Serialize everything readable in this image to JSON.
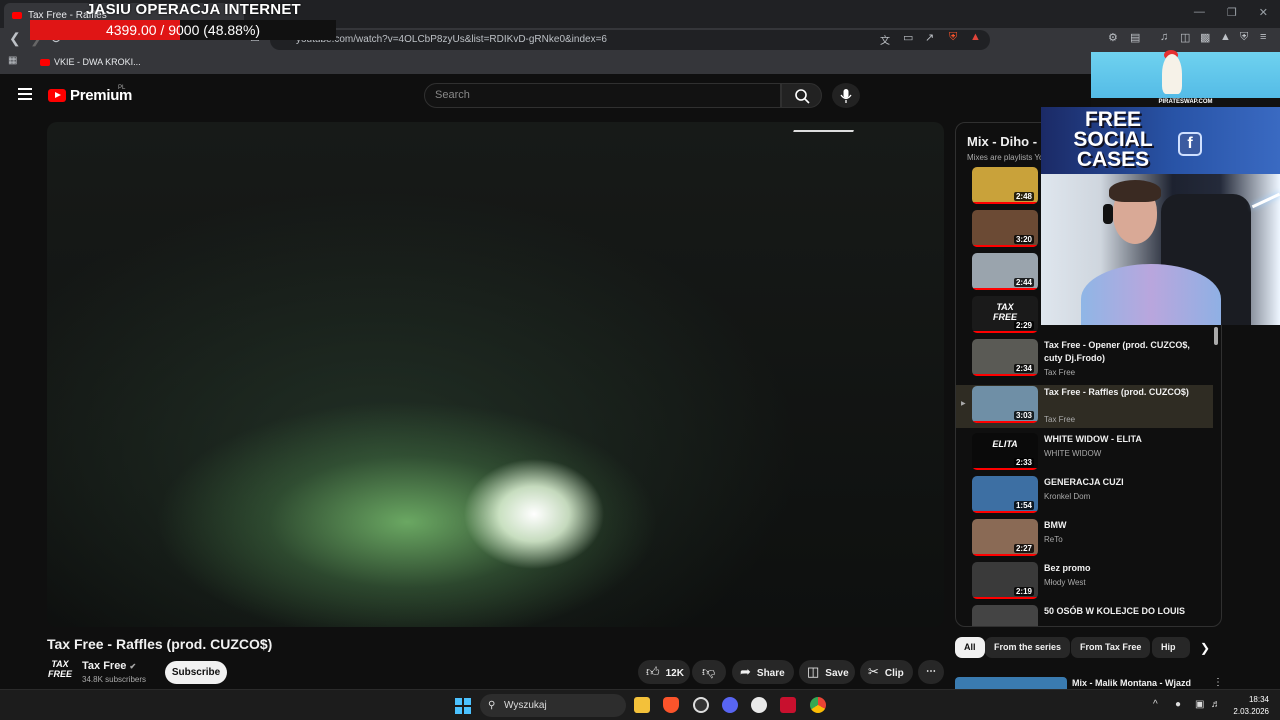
{
  "overlay": {
    "title": "JASIU OPERACJA INTERNET",
    "progress_text": "4399.00 / 9000 (48.88%)",
    "progress_fraction": 0.4888
  },
  "browser": {
    "tab_title": "Tax Free - Raffles",
    "url": "youtube.com/watch?v=4OLCbP8zyUs&list=RDIKvD-gRNke0&index=6",
    "bookmark_label": "VKIE - DWA KROKI..."
  },
  "youtube": {
    "logo_text": "Premium",
    "logo_region": "PL",
    "search_placeholder": "Search"
  },
  "video": {
    "title": "Tax Free - Raffles (prod. CUZCO$)",
    "channel_logo": "TAX FREE",
    "channel_name": "Tax Free",
    "subscribers": "34.8K subscribers",
    "subscribe_label": "Subscribe",
    "likes": "12K",
    "share_label": "Share",
    "save_label": "Save",
    "clip_label": "Clip"
  },
  "playlist": {
    "title": "Mix - Diho -",
    "subtitle": "Mixes are playlists Yo",
    "items": [
      {
        "title": "",
        "artist": "",
        "duration": "2:48",
        "color": "#c9a23a"
      },
      {
        "title": "",
        "artist": "",
        "duration": "3:20",
        "color": "#6b4a34"
      },
      {
        "title": "",
        "artist": "",
        "duration": "2:44",
        "color": "#9aa4ad"
      },
      {
        "title": "",
        "artist": "",
        "duration": "2:29",
        "color": "#1a1a1a",
        "thumb_text": "TAX FREE"
      },
      {
        "title": "Tax Free - Opener (prod. CUZCO$, cuty Dj.Frodo)",
        "artist": "Tax Free",
        "duration": "2:34",
        "color": "#5a5a55"
      },
      {
        "title": "Tax Free - Raffles (prod. CUZCO$)",
        "artist": "Tax Free",
        "duration": "3:03",
        "color": "#6f8fa6",
        "active": true
      },
      {
        "title": "WHITE WIDOW - ELITA",
        "artist": "WHITE WIDOW",
        "duration": "2:33",
        "color": "#0a0a0a",
        "thumb_text": "ELITA"
      },
      {
        "title": "GENERACJA CUZI",
        "artist": "Kronkel Dom",
        "duration": "1:54",
        "color": "#3d6fa3"
      },
      {
        "title": "BMW",
        "artist": "ReTo",
        "duration": "2:27",
        "color": "#8a6a55"
      },
      {
        "title": "Bez promo",
        "artist": "Młody West",
        "duration": "2:19",
        "color": "#3a3a3a"
      },
      {
        "title": "50 OSÓB W KOLEJCE DO LOUIS",
        "artist": "",
        "duration": "",
        "color": "#444"
      }
    ]
  },
  "chips": [
    "All",
    "From the series",
    "From Tax Free",
    "Hip ho"
  ],
  "next_up": "Mix - Malik Montana - Wjazd",
  "ads": {
    "domain": "PIRATESWAP.COM",
    "social_text": "FREE SOCIAL CASES"
  },
  "taskbar": {
    "search_label": "Wyszukaj",
    "time": "18:34",
    "date": "2.03.2026"
  }
}
